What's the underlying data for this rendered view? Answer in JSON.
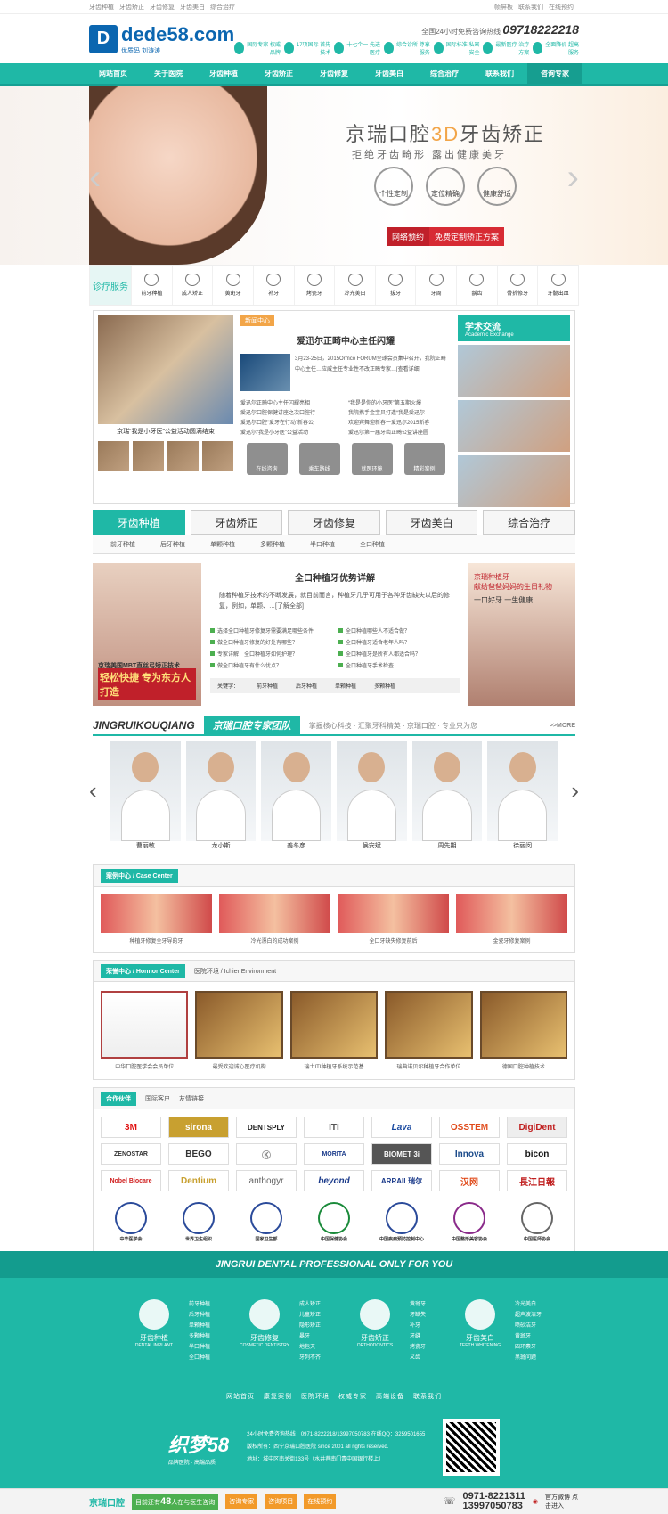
{
  "topbar": {
    "left": [
      "牙齿种植",
      "牙齿矫正",
      "牙齿修复",
      "牙齿美白",
      "综合治疗"
    ],
    "right": [
      "帧屏板",
      "联系我们",
      "在线预约"
    ]
  },
  "header": {
    "logo_mark": "D",
    "logo_text": "dede58.com",
    "logo_sub": "优质码 刘涛涛",
    "hotline_label": "全国24小时免费咨询热线",
    "hotline": "09718222218",
    "badges": [
      "国际专家 权威品牌",
      "17项国际 首先技术",
      "十七个一 先进医疗",
      "综合诊所 尊享服务",
      "国际标准 私密安全",
      "最新医疗 治疗方案",
      "全面降价 超高服务"
    ]
  },
  "nav": [
    "网站首页",
    "关于医院",
    "牙齿种植",
    "牙齿矫正",
    "牙齿修复",
    "牙齿美白",
    "综合治疗",
    "联系我们",
    "咨询专家"
  ],
  "banner": {
    "title_a": "京瑞口腔",
    "title_3d": "3D",
    "title_b": "牙齿矫正",
    "sub": "拒绝牙齿畸形 露出健康美牙",
    "circles": [
      "个性定制",
      "定位精确",
      "健康舒适"
    ],
    "btn_a": "网络预约",
    "btn_b": "免费定制矫正方案"
  },
  "services": {
    "head": "诊疗服务",
    "items": [
      "前牙种植",
      "成人矫正",
      "黄斑牙",
      "补牙",
      "烤瓷牙",
      "冷光美白",
      "拔牙",
      "牙周",
      "龋齿",
      "骨折修牙",
      "牙髓出血"
    ]
  },
  "news": {
    "photo_caption": "京瑞“我是小牙医”公益活动圆满结束",
    "tag": "新闻中心",
    "title": "爱迅尔正畸中心主任闪耀",
    "text": "3月23-25日，2015Ormco FORUM全球会员集中召开，我院正畸中心主任…应威主任专业性不改正畸专家…[查看详细]",
    "list": [
      "爱迅尔正畸中心主任闪耀亮相",
      "“我是是你的小牙医”第五期火爆",
      "爱迅尔口腔保健讲座之次口腔行",
      "我院携手金宝贝打造“我是爱迅尔",
      "爱迅尔口腔“爱牙在行动”新春公",
      "欢迎宾舞迎新春一爱迅尔2015新春",
      "爱迅尔“我是小牙医”公益活动",
      "爱迅尔第一届牙齿正畸公益讲座圆"
    ],
    "quick": [
      "在线咨询",
      "乘车路线",
      "就医环境",
      "精彩案例"
    ]
  },
  "academic": {
    "title": "学术交流",
    "sub": "Academic Exchange"
  },
  "tabs": [
    "牙齿种植",
    "牙齿矫正",
    "牙齿修复",
    "牙齿美白",
    "综合治疗"
  ],
  "subtabs": [
    "前牙种植",
    "后牙种植",
    "单颗种植",
    "多颗种植",
    "半口种植",
    "全口种植"
  ],
  "implant": {
    "left_t1": "京瑞美国MBT直丝弓矫正技术",
    "left_t2": "轻松快捷 专为东方人打造",
    "title": "全口种植牙优势详解",
    "text": "随着种植牙技术的不断发展，就目前而言，种植牙几乎可用于各种牙齿缺失以后的修复，例如，单颗、…[了解全部]",
    "list": [
      "选择全口种植牙修复牙需要满足哪些条件",
      "全口种植哪些人不适合做？",
      "做全口种植牙修复的好处有哪些？",
      "全口种植牙适合老年人吗？",
      "专家详解：全口种植牙如何护理？",
      "全口种植牙是所有人都适合吗？",
      "做全口种植牙有什么优点？",
      "全口种植牙手术检查"
    ],
    "kw_label": "关键字：",
    "kw": [
      "前牙种植",
      "后牙种植",
      "单颗种植",
      "多颗种植"
    ],
    "right_t1": "京瑞种植牙",
    "right_t2": "献给爸爸妈妈的生日礼物",
    "right_t3": "一口好牙 一生健康"
  },
  "team": {
    "en": "JINGRUIKOUQIANG",
    "cn": "京瑞口腔专家团队",
    "slogan": "掌握核心科技 · 汇聚牙科精英 · 京瑞口腔 · 专业只为您",
    "more": ">>MORE",
    "docs": [
      "曹丽敏",
      "龙小斯",
      "姜冬彦",
      "侯安斌",
      "周先期",
      "徐丽闵"
    ]
  },
  "cases": {
    "title": "案例中心 / Case Center",
    "items": [
      "种植牙修复全牙导的牙",
      "冷光漂白的成功案例",
      "全口牙缺失修复前后",
      "金瓷牙修复案例"
    ]
  },
  "honor": {
    "title": "荣誉中心 / Honnor Center",
    "env": "医院环境 / Ichier Environment",
    "items": [
      "中华口腔医学会会员单位",
      "最受欢迎诚心医疗机构",
      "瑞士ITI种植牙系统示范基",
      "瑞典诺贝尔种植牙合作单位",
      "德国口腔种植技术"
    ],
    "first_org": "中华口腔医学会",
    "first_badge": "会员单位",
    "third_big": "临床基地"
  },
  "partners": {
    "tabs": [
      "合作伙伴",
      "国际客户",
      "友情链接"
    ],
    "logos": [
      "3M",
      "sirona",
      "DENTSPLY",
      "ITI",
      "Lava",
      "OSSTEM",
      "DigiDent",
      "ZENOSTAR",
      "BEGO",
      "Ⓚ",
      "MORITA",
      "BIOMET 3i",
      "Innova",
      "bicon",
      "Nobel Biocare",
      "Dentium",
      "anthogyr",
      "beyond",
      "ARRAIL瑞尔",
      "汉网",
      "長江日報"
    ],
    "orgs": [
      "中华医学会",
      "世界卫生组织",
      "国家卫生部",
      "中国保健协会",
      "中国疾病预防控制中心",
      "中国整形美容协会",
      "中国医师协会"
    ]
  },
  "footer": {
    "head": "JINGRUI DENTAL PROFESSIONAL ONLY FOR YOU",
    "cats": [
      {
        "name": "牙齿种植",
        "en": "DENTAL IMPLANT",
        "links": [
          "前牙种植",
          "后牙种植",
          "单颗种植",
          "多颗种植",
          "半口种植",
          "全口种植"
        ]
      },
      {
        "name": "牙齿修复",
        "en": "COSMETIC DENTISTRY",
        "links": [
          "成人矫正",
          "儿童矫正",
          "隐形矫正",
          "暴牙",
          "地包天",
          "牙列不齐"
        ]
      },
      {
        "name": "牙齿矫正",
        "en": "ORTHODONTICS",
        "links": [
          "黄斑牙",
          "牙缺失",
          "补牙",
          "牙缝",
          "烤瓷牙",
          "义齿"
        ]
      },
      {
        "name": "牙齿美白",
        "en": "TEETH WHITENING",
        "links": [
          "冷光美白",
          "超声波洁牙",
          "喷砂洁牙",
          "黄斑牙",
          "四环素牙",
          "黑斑问题"
        ]
      }
    ],
    "nav": [
      "网站首页",
      "康复案例",
      "医院环境",
      "权威专家",
      "高端设备",
      "联系我们"
    ],
    "logo": "织梦58",
    "logo_sub": "品牌医院 · 高端品质",
    "info": [
      "24小时免费咨询热线：0971-8222218/13997050783 在线QQ：3259501655",
      "版权所有：西宁京瑞口腔医院 since 2001 all rights reserved.",
      "地址：城中区南关街133号（水井巷南门青中国银行楼上）"
    ]
  },
  "bar": {
    "brand": "京瑞口腔",
    "online_pre": "目前还有",
    "online_num": "48",
    "online_post": "人在与医生咨询",
    "b1": "咨询专家",
    "b2": "咨询项目",
    "b3": "在线预约",
    "tel1": "0971-8221311",
    "tel2": "13997050783",
    "weibo": "官方微博 点击进入"
  }
}
